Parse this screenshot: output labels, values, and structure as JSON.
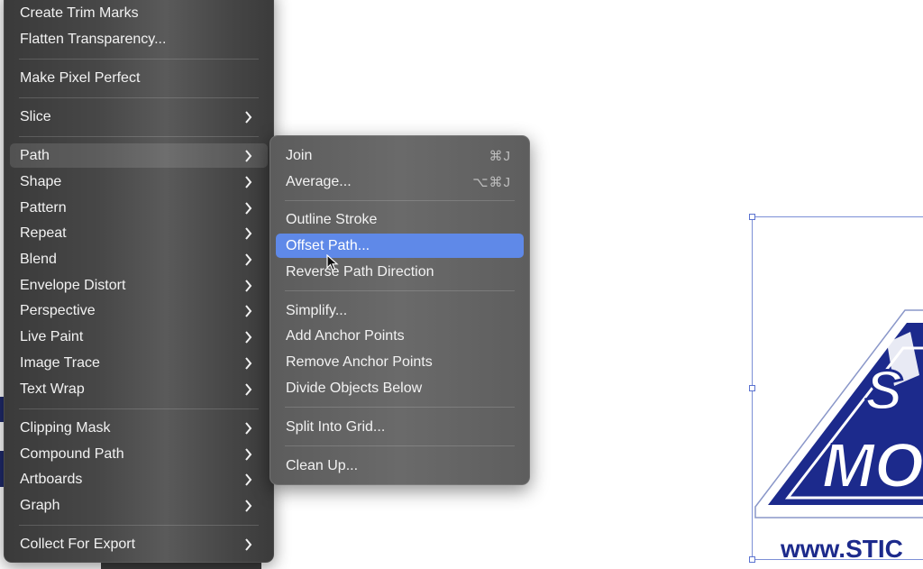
{
  "main_menu": {
    "items": [
      {
        "label": "Create Trim Marks",
        "submenu": false
      },
      {
        "label": "Flatten Transparency...",
        "submenu": false
      },
      {
        "label": "Make Pixel Perfect",
        "submenu": false
      },
      {
        "label": "Slice",
        "submenu": true
      },
      {
        "label": "Path",
        "submenu": true,
        "active": true
      },
      {
        "label": "Shape",
        "submenu": true
      },
      {
        "label": "Pattern",
        "submenu": true
      },
      {
        "label": "Repeat",
        "submenu": true
      },
      {
        "label": "Blend",
        "submenu": true
      },
      {
        "label": "Envelope Distort",
        "submenu": true
      },
      {
        "label": "Perspective",
        "submenu": true
      },
      {
        "label": "Live Paint",
        "submenu": true
      },
      {
        "label": "Image Trace",
        "submenu": true
      },
      {
        "label": "Text Wrap",
        "submenu": true
      },
      {
        "label": "Clipping Mask",
        "submenu": true
      },
      {
        "label": "Compound Path",
        "submenu": true
      },
      {
        "label": "Artboards",
        "submenu": true
      },
      {
        "label": "Graph",
        "submenu": true
      },
      {
        "label": "Collect For Export",
        "submenu": true
      }
    ]
  },
  "path_submenu": {
    "items": [
      {
        "label": "Join",
        "shortcut": "⌘J"
      },
      {
        "label": "Average...",
        "shortcut": "⌥⌘J"
      },
      {
        "label": "Outline Stroke",
        "shortcut": ""
      },
      {
        "label": "Offset Path...",
        "shortcut": "",
        "highlighted": true
      },
      {
        "label": "Reverse Path Direction",
        "shortcut": ""
      },
      {
        "label": "Simplify...",
        "shortcut": ""
      },
      {
        "label": "Add Anchor Points",
        "shortcut": ""
      },
      {
        "label": "Remove Anchor Points",
        "shortcut": ""
      },
      {
        "label": "Divide Objects Below",
        "shortcut": ""
      },
      {
        "label": "Split Into Grid...",
        "shortcut": ""
      },
      {
        "label": "Clean Up...",
        "shortcut": ""
      }
    ]
  },
  "artwork": {
    "line1": "S",
    "line2": "MO",
    "url": "www.STIC"
  },
  "colors": {
    "highlight": "#5f89e8",
    "artwork_navy": "#1c2a8c",
    "selection": "#7c8fd6"
  },
  "icons": {
    "chevron": "chevron-right-icon",
    "cursor": "arrow-cursor-icon"
  }
}
